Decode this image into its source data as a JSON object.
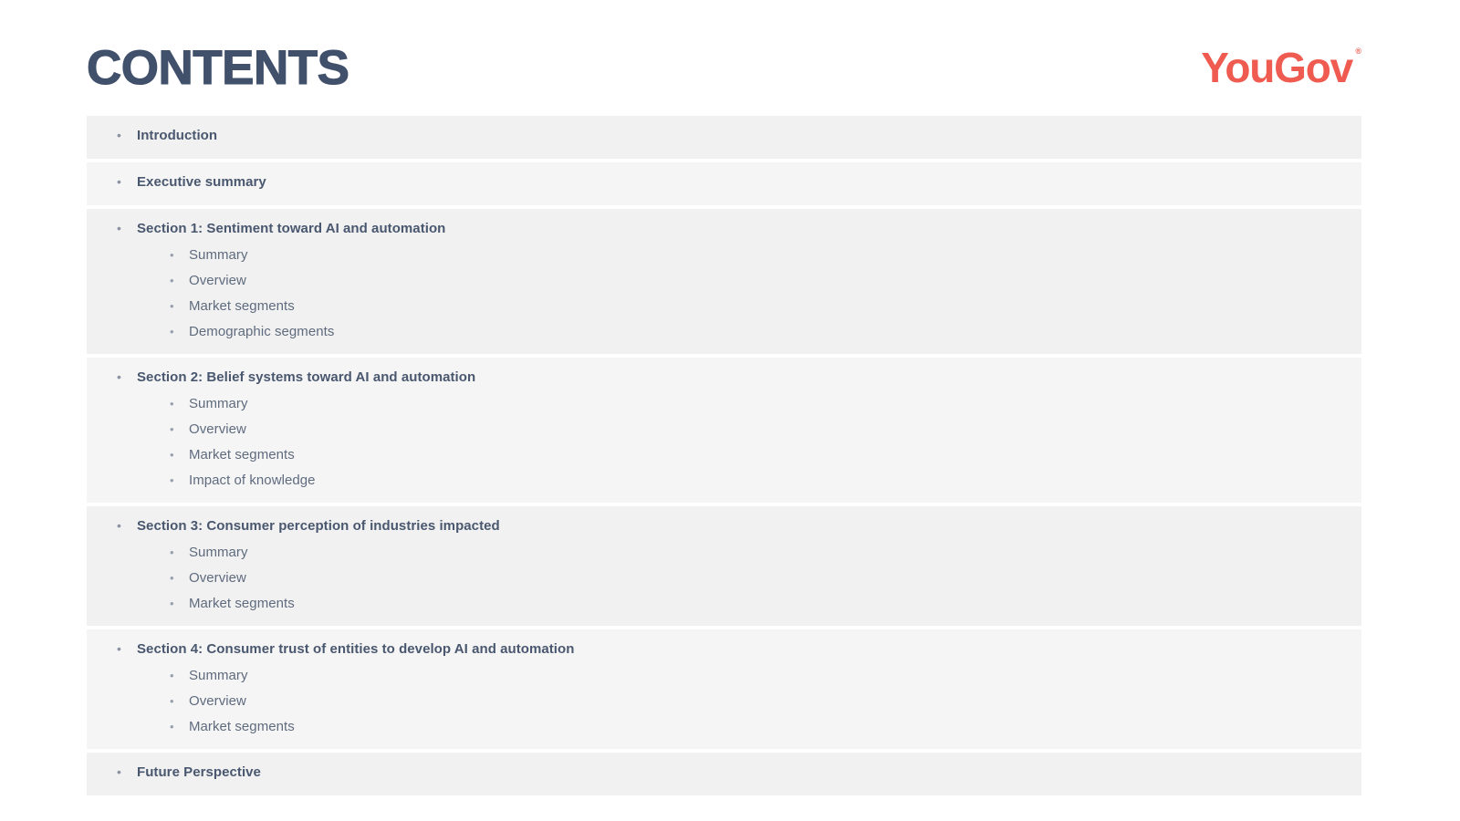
{
  "header": {
    "title": "CONTENTS",
    "logo_text": "YouGov",
    "logo_registered": "®",
    "logo_color": "#ef5b50",
    "title_color": "#41506b"
  },
  "bullets": {
    "level1_glyph": "•",
    "level2_glyph": "•"
  },
  "toc": {
    "sections": [
      {
        "label": "Introduction",
        "shade": "shade-a",
        "items": []
      },
      {
        "label": "Executive summary",
        "shade": "shade-b",
        "items": []
      },
      {
        "label": "Section 1: Sentiment toward AI and automation",
        "shade": "shade-a",
        "items": [
          "Summary",
          "Overview",
          "Market segments",
          "Demographic segments"
        ]
      },
      {
        "label": "Section 2: Belief systems toward AI and automation",
        "shade": "shade-b",
        "items": [
          "Summary",
          "Overview",
          "Market segments",
          "Impact of knowledge"
        ]
      },
      {
        "label": "Section 3: Consumer perception of industries impacted",
        "shade": "shade-a",
        "items": [
          "Summary",
          "Overview",
          "Market segments"
        ]
      },
      {
        "label": "Section 4: Consumer trust of entities to develop AI and automation",
        "shade": "shade-b",
        "items": [
          "Summary",
          "Overview",
          "Market segments"
        ]
      },
      {
        "label": "Future Perspective",
        "shade": "shade-a",
        "items": []
      }
    ]
  }
}
